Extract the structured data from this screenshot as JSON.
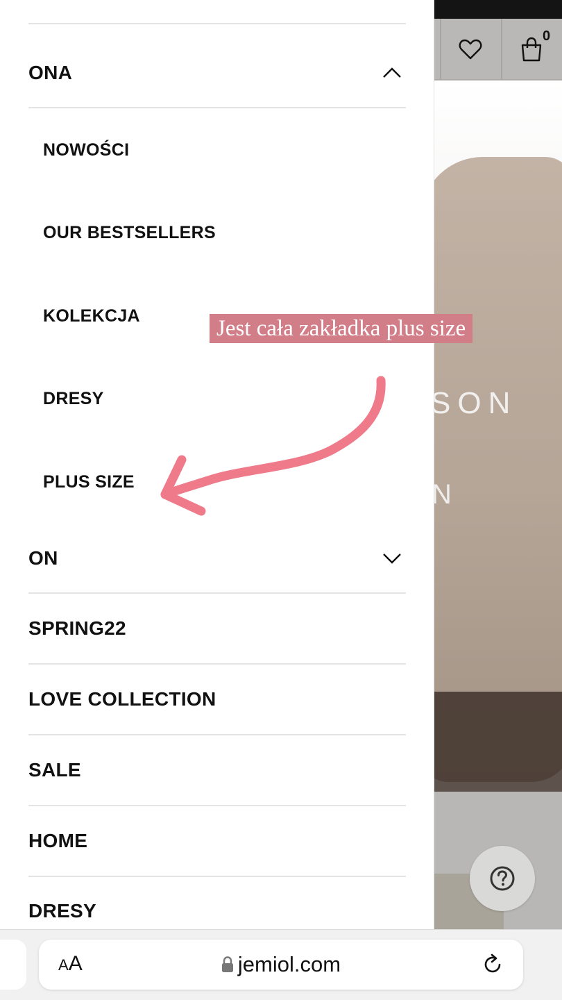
{
  "drawer": {
    "main_items": [
      {
        "label": "ONA"
      },
      {
        "label": "ON"
      },
      {
        "label": "SPRING22"
      },
      {
        "label": "LOVE COLLECTION"
      },
      {
        "label": "SALE"
      },
      {
        "label": "HOME"
      },
      {
        "label": "DRESY"
      }
    ],
    "sub_items": [
      {
        "label": "NOWOŚCI"
      },
      {
        "label": "OUR BESTSELLERS"
      },
      {
        "label": "KOLEKCJA"
      },
      {
        "label": "DRESY"
      },
      {
        "label": "PLUS SIZE"
      }
    ]
  },
  "header": {
    "cart_count": "0"
  },
  "hero": {
    "text_fragment_1": "SON",
    "text_fragment_2": "N"
  },
  "annotation": {
    "text": "Jest cała zakładka plus size",
    "color": "#d27e89"
  },
  "browser": {
    "text_size_label": "AA",
    "url": "jemiol.com"
  },
  "icons": {
    "wishlist": "heart-icon",
    "cart": "shopping-bag-icon",
    "help": "question-mark-icon",
    "lock": "lock-icon",
    "reload": "reload-icon",
    "expand": "chevron-down-icon",
    "collapse": "chevron-up-icon"
  }
}
